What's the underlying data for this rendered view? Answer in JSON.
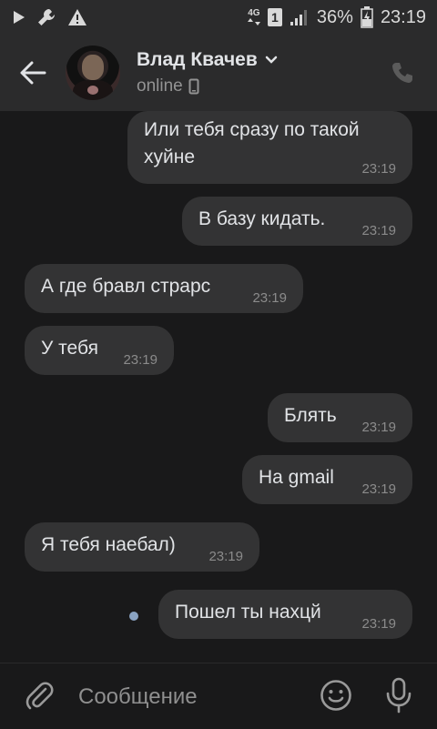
{
  "status_bar": {
    "icons": [
      "play-icon",
      "wrench-icon",
      "warning-icon",
      "4g-icon",
      "sim-1-icon",
      "signal-icon",
      "battery-charging-icon"
    ],
    "network_label": "4G",
    "sim_label": "1",
    "battery_percent": "36%",
    "time": "23:19"
  },
  "header": {
    "contact_name": "Влад Квачев",
    "status": "online"
  },
  "messages": [
    {
      "id": "m1",
      "direction": "outgoing",
      "text": "Или тебя сразу по такой хуйне",
      "time": "23:19"
    },
    {
      "id": "m2",
      "direction": "outgoing",
      "text": "В базу кидать.",
      "time": "23:19"
    },
    {
      "id": "m3",
      "direction": "incoming",
      "text": "А где бравл страрс",
      "time": "23:19"
    },
    {
      "id": "m4",
      "direction": "incoming",
      "text": "У тебя",
      "time": "23:19"
    },
    {
      "id": "m5",
      "direction": "outgoing",
      "text": "Блять",
      "time": "23:19"
    },
    {
      "id": "m6",
      "direction": "outgoing",
      "text": "На gmail",
      "time": "23:19"
    },
    {
      "id": "m7",
      "direction": "incoming",
      "text": "Я тебя наебал)",
      "time": "23:19"
    },
    {
      "id": "m8",
      "direction": "outgoing",
      "text": "Пошел ты нахцй",
      "time": "23:19",
      "unread": true
    }
  ],
  "input": {
    "placeholder": "Сообщение",
    "value": ""
  },
  "colors": {
    "background": "#19191a",
    "bar": "#2b2b2c",
    "bubble": "#333334",
    "unread_dot": "#8aa3c2"
  }
}
